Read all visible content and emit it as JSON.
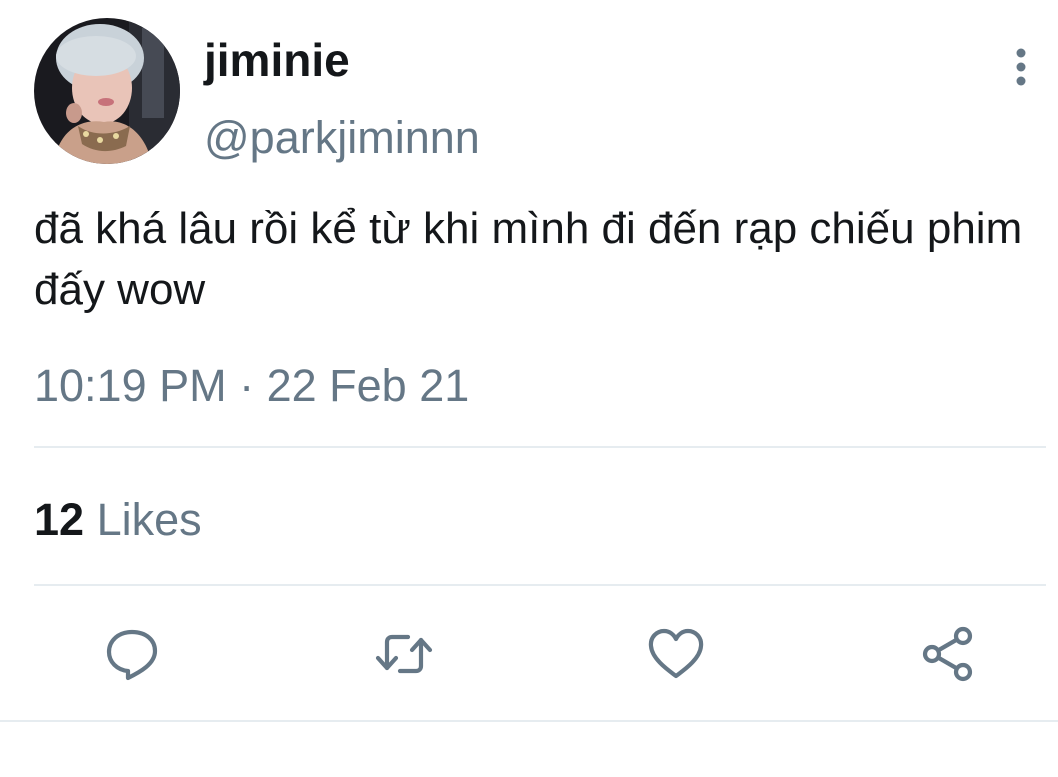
{
  "user": {
    "display_name": "jiminie",
    "handle": "@parkjiminnn"
  },
  "tweet": {
    "text": "đã khá lâu rồi kể từ khi mình đi đến rạp chiếu phim đấy wow",
    "timestamp": "10:19 PM · 22 Feb 21"
  },
  "stats": {
    "likes_count": "12",
    "likes_label": "Likes"
  },
  "actions": {
    "icons": [
      "reply-icon",
      "retweet-icon",
      "like-icon",
      "share-icon"
    ]
  },
  "colors": {
    "primary_text": "#14171a",
    "secondary_text": "#657786",
    "divider": "#e6ecf0"
  }
}
